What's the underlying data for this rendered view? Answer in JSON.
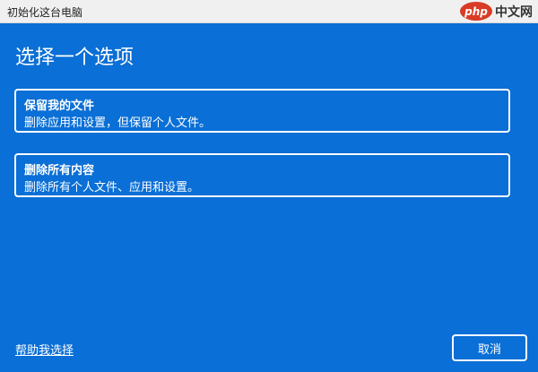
{
  "window": {
    "title": "初始化这台电脑"
  },
  "watermark": {
    "logo_text": "php",
    "site_text": "中文网"
  },
  "heading": "选择一个选项",
  "options": [
    {
      "title": "保留我的文件",
      "description": "删除应用和设置，但保留个人文件。"
    },
    {
      "title": "删除所有内容",
      "description": "删除所有个人文件、应用和设置。"
    }
  ],
  "footer": {
    "help_link": "帮助我选择",
    "cancel_label": "取消"
  },
  "colors": {
    "background": "#0a6fd6",
    "foreground": "#ffffff",
    "titlebar": "#f0f0f0"
  }
}
